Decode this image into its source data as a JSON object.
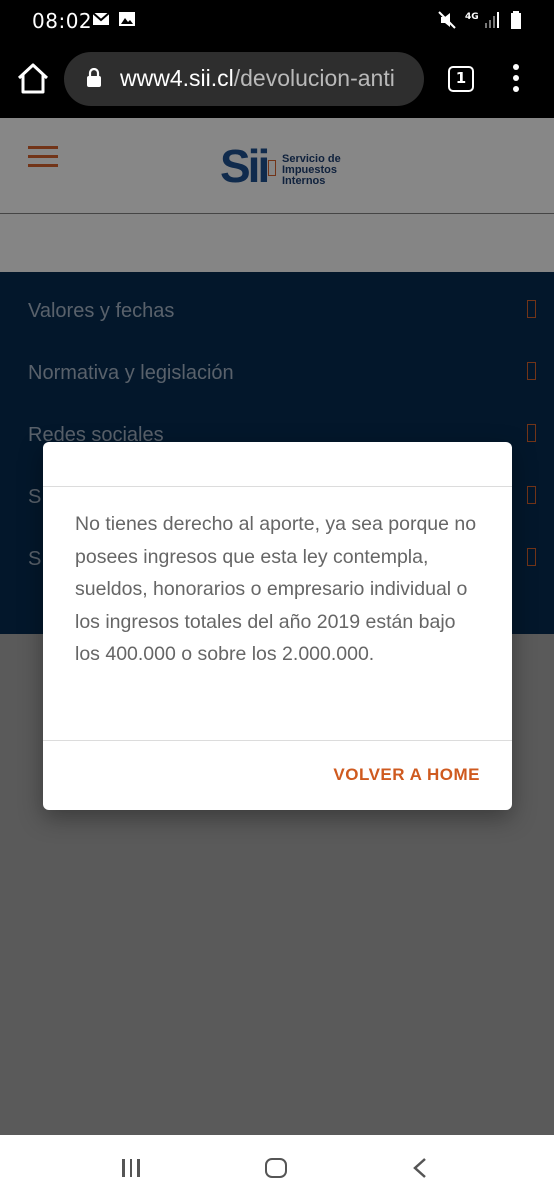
{
  "status_bar": {
    "time": "08:02",
    "network": "4G"
  },
  "browser": {
    "url_host": "www4.sii.cl",
    "url_path": "/devolucion-anti",
    "tab_count": "1"
  },
  "site": {
    "logo_mark": "Sii",
    "logo_text": [
      "Servicio de",
      "Impuestos",
      "Internos"
    ]
  },
  "nav": {
    "items": [
      {
        "label": "Valores y fechas"
      },
      {
        "label": "Normativa y legislación"
      },
      {
        "label": "Redes sociales"
      },
      {
        "label": "S"
      },
      {
        "label": "S"
      }
    ]
  },
  "dialog": {
    "message": "No tienes derecho al aporte, ya sea porque no posees ingresos que esta ley contempla, sueldos, honorarios o empresario individual o los ingresos totales del año 2019 están bajo los 400.000 o sobre los 2.000.000.",
    "button_label": "VOLVER A HOME"
  },
  "colors": {
    "accent": "#cf5a1f",
    "nav_bg": "#06294a",
    "logo_blue": "#1d4a85"
  }
}
